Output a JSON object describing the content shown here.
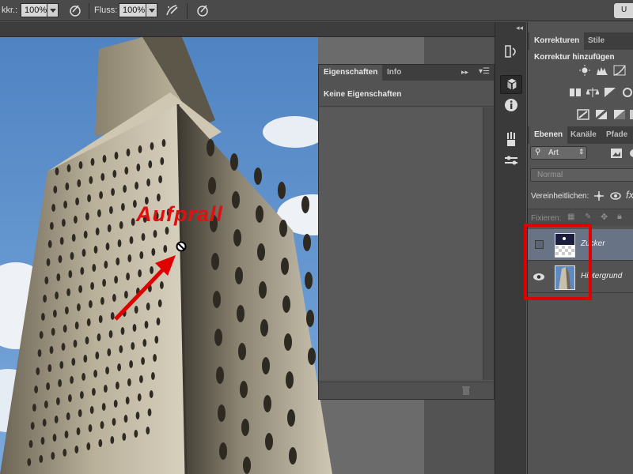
{
  "toolbar": {
    "deckkraft_label": "kkr.:",
    "deckkraft_value": "100%",
    "fluss_label": "Fluss:",
    "fluss_value": "100%",
    "right_button": "U"
  },
  "properties_panel": {
    "tabs": [
      {
        "label": "Eigenschaften",
        "active": true
      },
      {
        "label": "Info",
        "active": false
      }
    ],
    "empty_text": "Keine Eigenschaften"
  },
  "korrekturen_panel": {
    "tabs": [
      {
        "label": "Korrekturen",
        "active": true
      },
      {
        "label": "Stile",
        "active": false
      }
    ],
    "heading": "Korrektur hinzufügen"
  },
  "layers_panel": {
    "tabs": [
      {
        "label": "Ebenen",
        "active": true
      },
      {
        "label": "Kanäle",
        "active": false
      },
      {
        "label": "Pfade",
        "active": false
      }
    ],
    "filter_label": "Art",
    "blend_mode": "Normal",
    "unify_label": "Vereinheitlichen:",
    "lock_label": "Fixieren:",
    "layers": [
      {
        "name": "Zucker",
        "visible": false,
        "selected": true
      },
      {
        "name": "Hintergrund",
        "visible": true,
        "selected": false
      }
    ]
  },
  "annotation": {
    "text": "Aufprall",
    "color": "#e01010"
  },
  "colors": {
    "ui_background": "#535353",
    "highlight_box": "#e10000",
    "sky": "#5c8fc8"
  }
}
